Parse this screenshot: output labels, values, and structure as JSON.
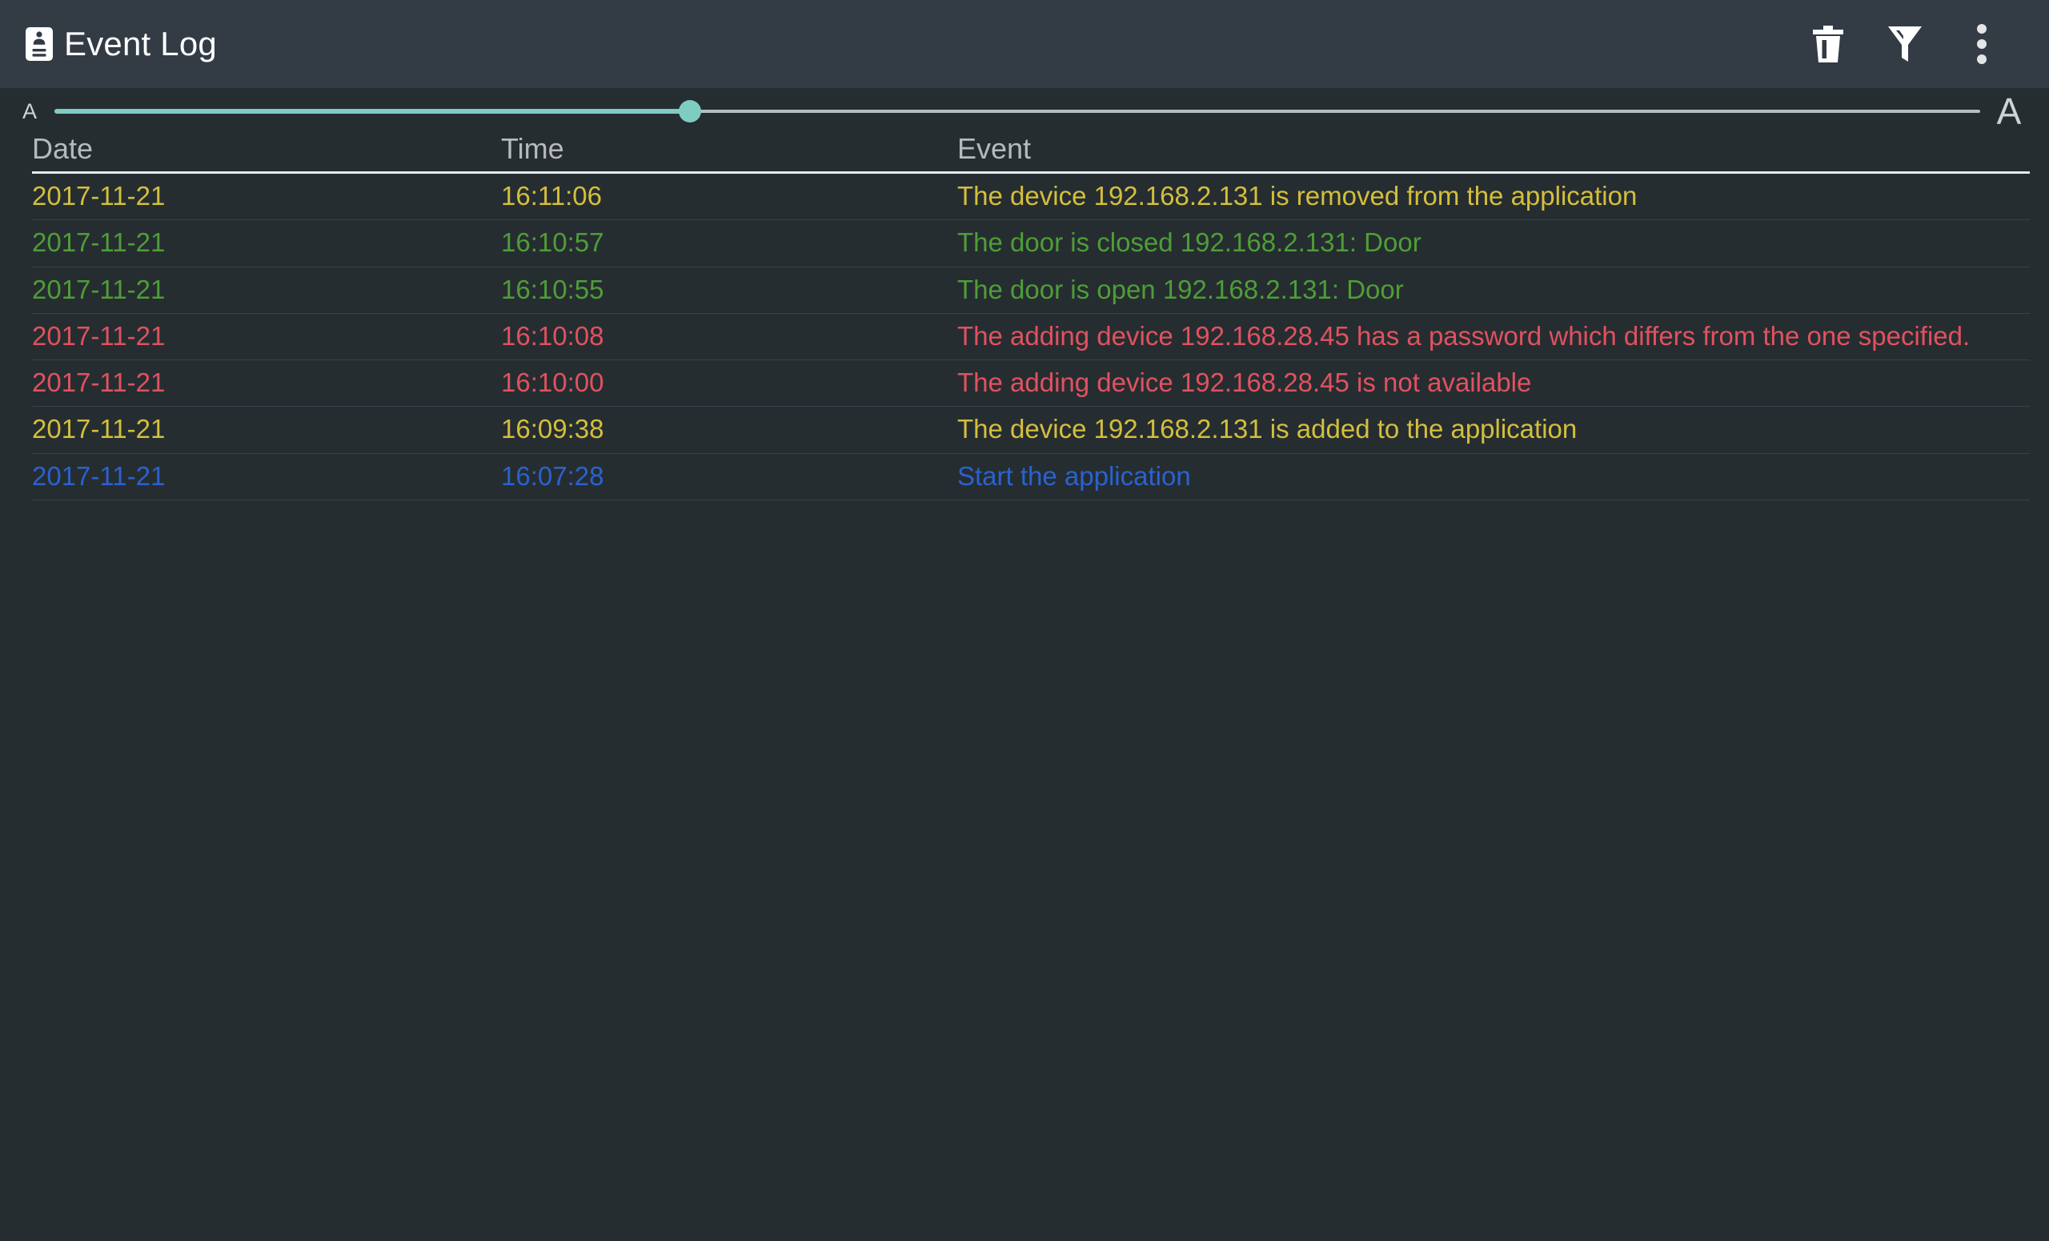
{
  "app": {
    "title": "Event Log",
    "icon": "contact-badge-icon"
  },
  "toolbar": {
    "actions": [
      {
        "name": "delete-button",
        "icon": "trash-icon",
        "label": "Delete"
      },
      {
        "name": "filter-button",
        "icon": "filter-icon",
        "label": "Filter"
      },
      {
        "name": "overflow-menu-button",
        "icon": "more-vertical-icon",
        "label": "More options"
      }
    ]
  },
  "font_size_slider": {
    "small_label": "A",
    "large_label": "A",
    "value_percent": 33,
    "track_color": "#b9bdc0",
    "accent_color": "#7fccc3"
  },
  "table": {
    "headers": {
      "date": "Date",
      "time": "Time",
      "event": "Event"
    },
    "colors": {
      "warning": "#d4bf3c",
      "success": "#4e9e37",
      "error": "#e0525f",
      "info": "#2a62cf"
    },
    "rows": [
      {
        "date": "2017-11-21",
        "time": "16:11:06",
        "event": "The device 192.168.2.131 is removed from the application",
        "level": "warning"
      },
      {
        "date": "2017-11-21",
        "time": "16:10:57",
        "event": "The door is closed 192.168.2.131: Door",
        "level": "success"
      },
      {
        "date": "2017-11-21",
        "time": "16:10:55",
        "event": "The door is open 192.168.2.131: Door",
        "level": "success"
      },
      {
        "date": "2017-11-21",
        "time": "16:10:08",
        "event": "The adding device 192.168.28.45 has a password which differs from the one specified.",
        "level": "error"
      },
      {
        "date": "2017-11-21",
        "time": "16:10:00",
        "event": "The adding device 192.168.28.45 is not available",
        "level": "error"
      },
      {
        "date": "2017-11-21",
        "time": "16:09:38",
        "event": "The device 192.168.2.131 is added to the application",
        "level": "warning"
      },
      {
        "date": "2017-11-21",
        "time": "16:07:28",
        "event": "Start the application",
        "level": "info"
      }
    ]
  }
}
